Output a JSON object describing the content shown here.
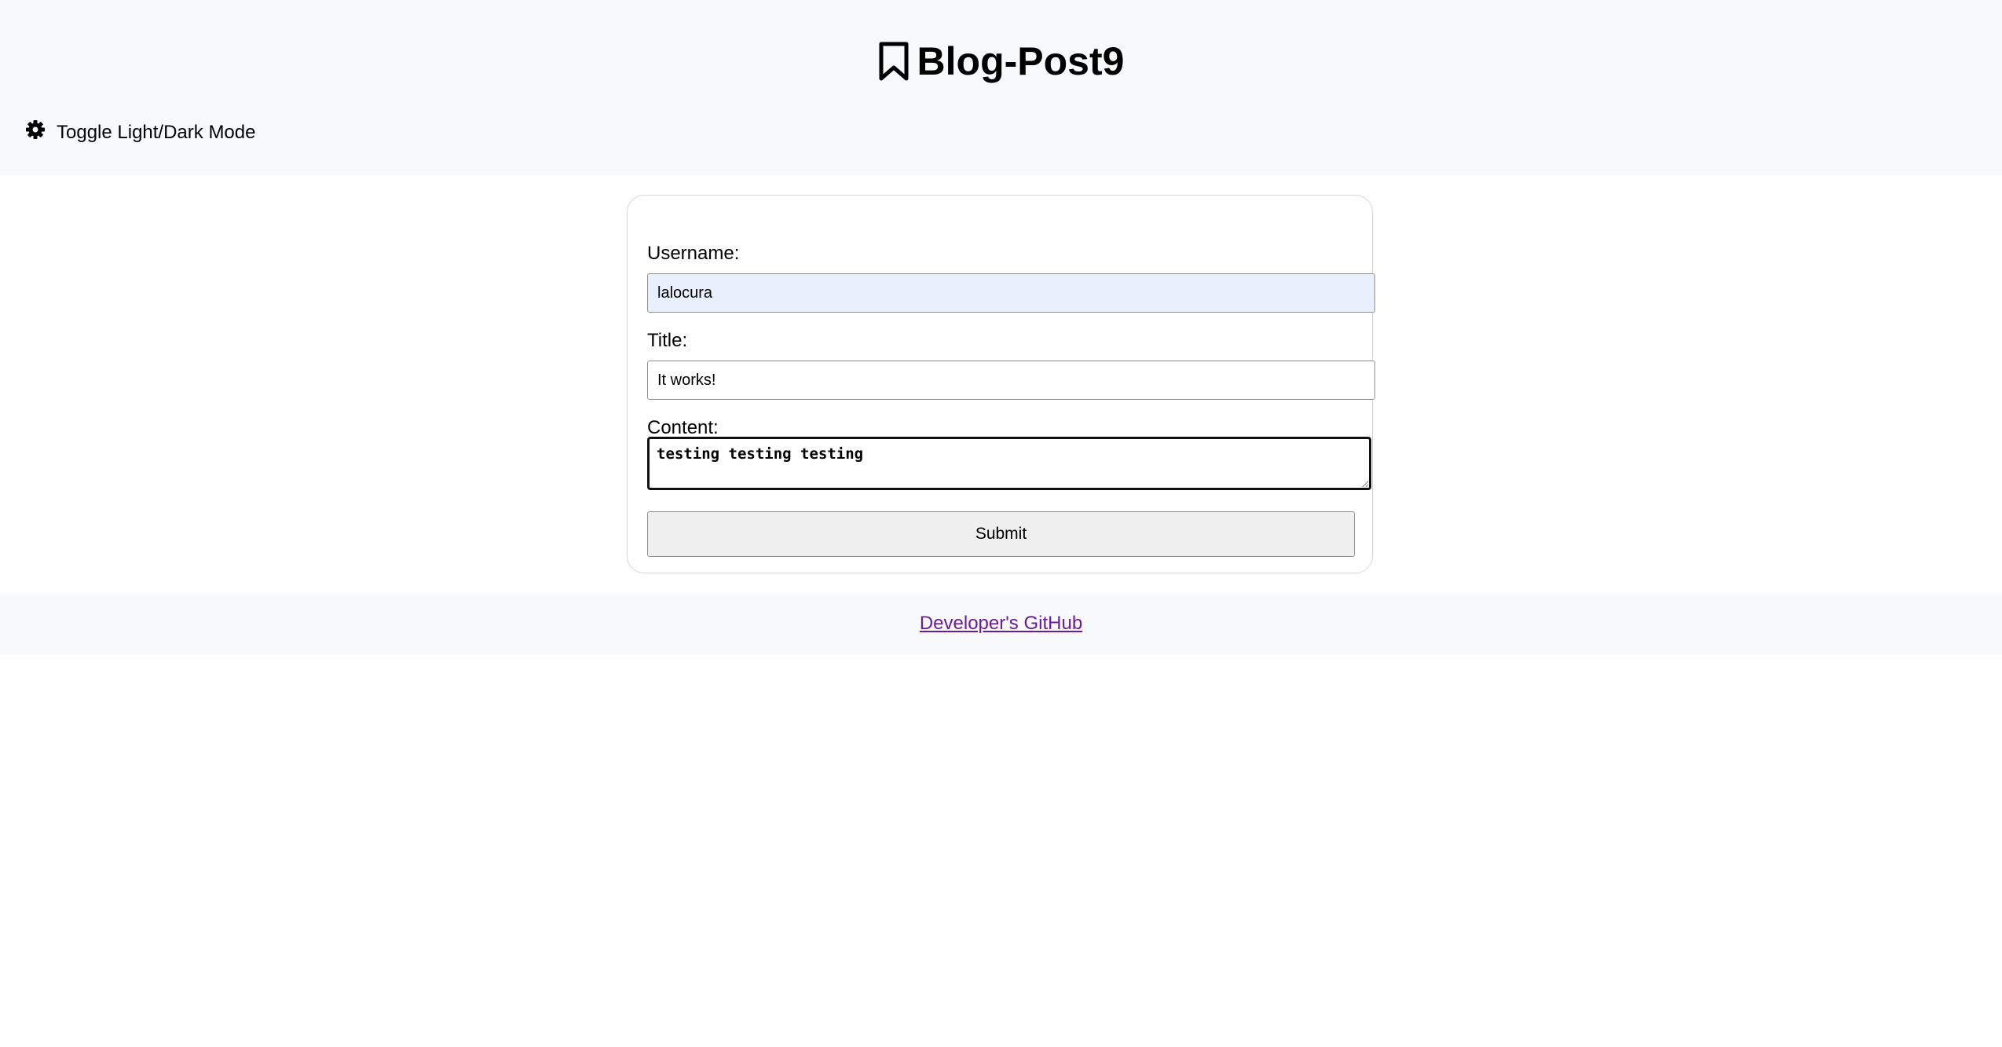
{
  "header": {
    "title": "Blog-Post9",
    "title_icon": "bookmark-icon",
    "theme_toggle": {
      "icon": "gear-icon",
      "label": "Toggle Light/Dark Mode"
    }
  },
  "form": {
    "username": {
      "label": "Username:",
      "value": "lalocura"
    },
    "title": {
      "label": "Title:",
      "value": "It works!"
    },
    "content": {
      "label": "Content:",
      "value": "testing testing testing"
    },
    "submit_label": "Submit"
  },
  "footer": {
    "link_text": "Developer's GitHub"
  },
  "colors": {
    "header_bg": "#f8f9fa",
    "autofill_bg": "#e8f0fe",
    "link_visited": "#6a1b9a",
    "button_bg": "#efefef"
  }
}
